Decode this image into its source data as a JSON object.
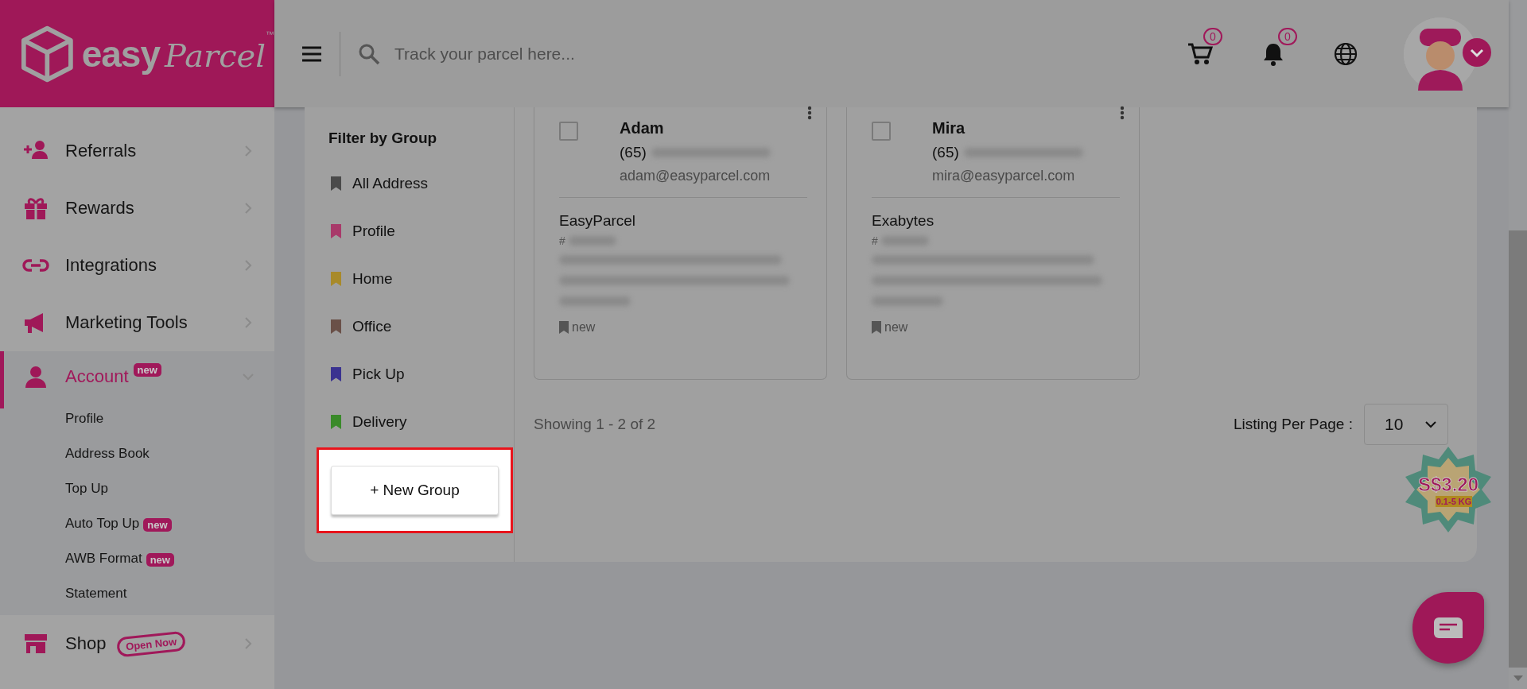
{
  "header": {
    "logo": {
      "brand_first": "easy",
      "brand_second": "Parcel",
      "trademark": "™"
    },
    "search": {
      "placeholder": "Track your parcel here..."
    },
    "cart_count": "0",
    "notification_count": "0"
  },
  "sidebar": {
    "items": [
      {
        "label": "Referrals",
        "selected": false,
        "expanded": false
      },
      {
        "label": "Rewards",
        "selected": false,
        "expanded": false
      },
      {
        "label": "Integrations",
        "selected": false,
        "expanded": false
      },
      {
        "label": "Marketing Tools",
        "selected": false,
        "expanded": false
      },
      {
        "label": "Account",
        "selected": true,
        "expanded": true,
        "badge": {
          "text": "new",
          "kind": "filled"
        },
        "children": [
          {
            "label": "Profile",
            "selected": false
          },
          {
            "label": "Address Book",
            "selected": false
          },
          {
            "label": "Top Up",
            "selected": false
          },
          {
            "label": "Auto Top Up",
            "selected": false,
            "badge": {
              "text": "new",
              "kind": "filled"
            }
          },
          {
            "label": "AWB Format",
            "selected": false,
            "badge": {
              "text": "new",
              "kind": "filled"
            }
          },
          {
            "label": "Statement",
            "selected": false
          }
        ]
      },
      {
        "label": "Shop",
        "selected": false,
        "expanded": false,
        "badge": {
          "text": "Open Now",
          "kind": "outline"
        }
      }
    ]
  },
  "filter": {
    "title": "Filter by Group",
    "groups": [
      {
        "label": "All Address",
        "color": "#4a4a4a"
      },
      {
        "label": "Profile",
        "color": "#a83a6a"
      },
      {
        "label": "Home",
        "color": "#a88a2a"
      },
      {
        "label": "Office",
        "color": "#6a5048"
      },
      {
        "label": "Pick Up",
        "color": "#3a3290"
      },
      {
        "label": "Delivery",
        "color": "#3a8a2a"
      }
    ],
    "new_group_button": {
      "label": "+ New Group",
      "highlighted": true
    }
  },
  "cards": [
    {
      "name": "Adam",
      "phone_prefix": "(65)",
      "email": "adam@easyparcel.com",
      "company": "EasyParcel",
      "reference_prefix": "#",
      "tag": "new",
      "checked": false
    },
    {
      "name": "Mira",
      "phone_prefix": "(65)",
      "email": "mira@easyparcel.com",
      "company": "Exabytes",
      "reference_prefix": "#",
      "tag": "new",
      "checked": false
    }
  ],
  "pagination": {
    "summary": "Showing 1 - 2 of 2",
    "per_page_label": "Listing Per Page :",
    "per_page_value": "10"
  },
  "promo": {
    "price": "S$3.20",
    "weight": "0.1-5 KG"
  }
}
